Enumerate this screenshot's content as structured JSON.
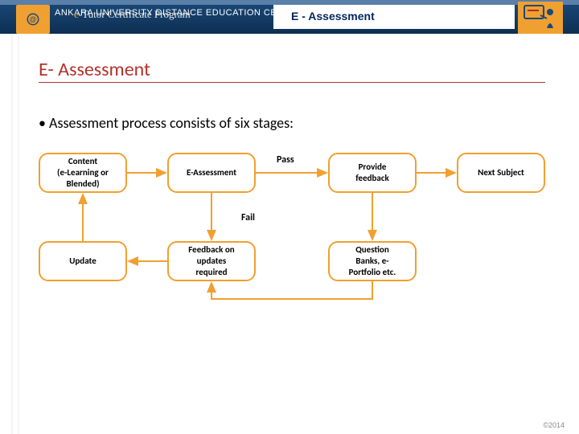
{
  "banner": {
    "org_line": "ANKARA UNIVERSITY DISTANCE EDUCATION CENTER",
    "program_prefix_e": "e",
    "program_prefix_dash": "-",
    "program_word": "Tutor Certificate Program",
    "center_title": "E - Assessment"
  },
  "title": "E- Assessment",
  "bullet": "• Assessment process consists of six stages:",
  "nodes": {
    "content": "Content\n(e-Learning or\nBlended)",
    "eassess": "E-Assessment",
    "provide": "Provide\nfeedback",
    "next": "Next Subject",
    "update": "Update",
    "feedback_req": "Feedback on\nupdates\nrequired",
    "qbanks": "Question\nBanks, e-\nPortfolio etc."
  },
  "labels": {
    "pass": "Pass",
    "fail": "Fail"
  },
  "footer": "©2014"
}
